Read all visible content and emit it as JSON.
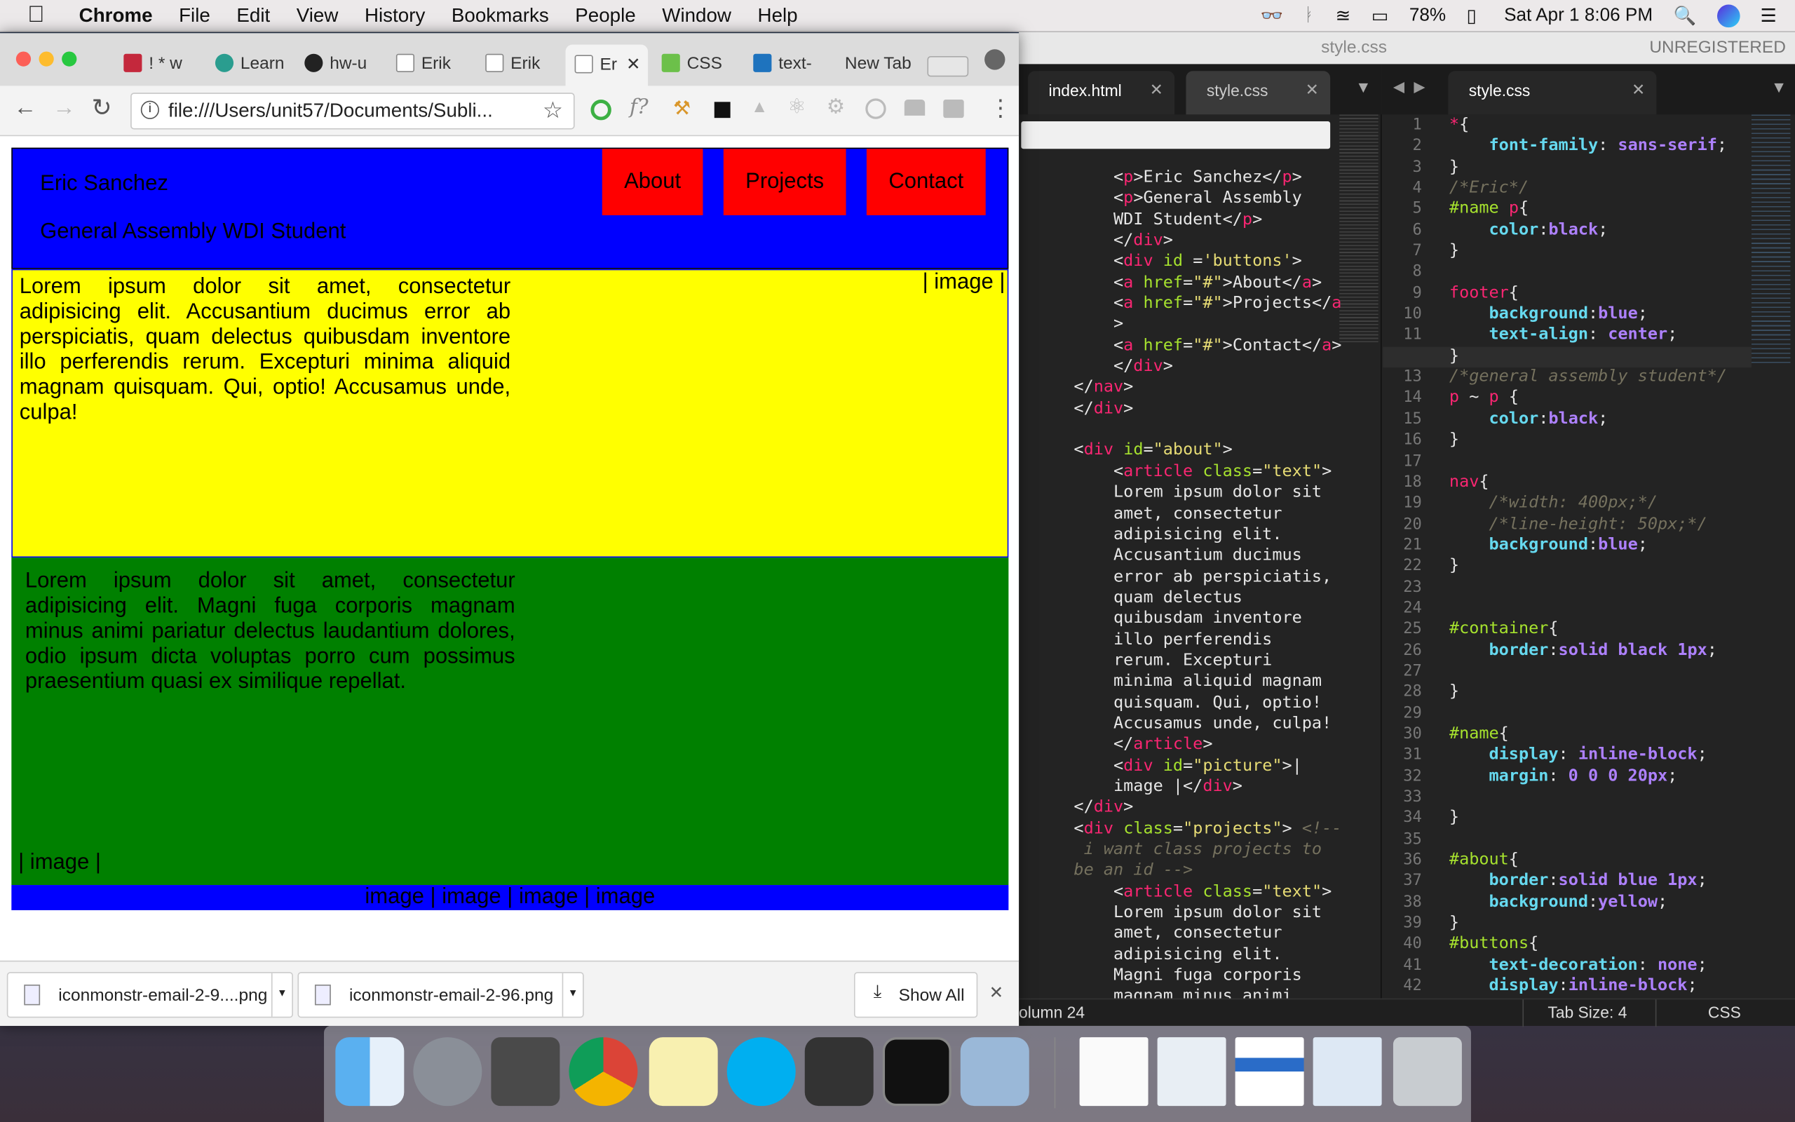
{
  "menubar": {
    "app": "Chrome",
    "items": [
      "File",
      "Edit",
      "View",
      "History",
      "Bookmarks",
      "People",
      "Window",
      "Help"
    ],
    "battery": "78%",
    "datetime": "Sat Apr 1  8:06 PM"
  },
  "chrome": {
    "tabs": [
      "! * w",
      "Learn",
      "hw-u",
      "Erik",
      "Erik",
      "Er",
      "CSS",
      "text-",
      "New Tab"
    ],
    "url": "file:///Users/unit57/Documents/Subli...",
    "page": {
      "name": "Eric Sanchez",
      "subtitle": "General Assembly WDI Student",
      "nav": [
        "About",
        "Projects",
        "Contact"
      ],
      "about_text": "Lorem ipsum dolor sit amet, consectetur adipisicing elit. Accusantium ducimus error ab perspiciatis, quam delectus quibusdam inventore illo perferendis rerum. Excepturi minima aliquid magnam quisquam. Qui, optio! Accusamus unde, culpa!",
      "picture": "| image |",
      "projects_text": "Lorem ipsum dolor sit amet, consectetur adipisicing elit. Magni fuga corporis magnam minus animi pariatur delectus laudantium dolores, odio ipsum dicta voluptas porro cum possimus praesentium quasi ex similique repellat.",
      "projects_image": "| image |",
      "footer": "image | image | image | image"
    },
    "downloads": [
      "iconmonstr-email-2-9....png",
      "iconmonstr-email-2-96.png"
    ],
    "show_all": "Show All"
  },
  "sublime": {
    "title": "style.css",
    "unregistered": "UNREGISTERED",
    "left_tabs": [
      "index.html",
      "style.css"
    ],
    "right_tab": "style.css",
    "status": {
      "position": "olumn 24",
      "tab_size": "Tab Size: 4",
      "syntax": "CSS"
    }
  },
  "colors": {
    "nav": "#0000ff",
    "about": "#ffff00",
    "projects": "#008000",
    "button": "#ff0000"
  }
}
